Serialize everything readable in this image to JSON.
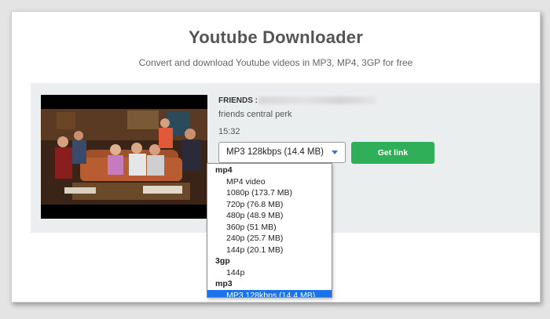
{
  "header": {
    "title": "Youtube Downloader",
    "subtitle": "Convert and download Youtube videos in MP3, MP4, 3GP for free"
  },
  "video": {
    "title_prefix": "FRIENDS :",
    "description": "friends central perk",
    "duration": "15:32"
  },
  "format_select": {
    "selected_value": "MP3 128kbps (14.4 MB)",
    "groups": [
      {
        "label": "mp4",
        "options": [
          "MP4 video",
          "1080p (173.7 MB)",
          "720p (76.8 MB)",
          "480p (48.9 MB)",
          "360p (51 MB)",
          "240p (25.7 MB)",
          "144p (20.1 MB)"
        ]
      },
      {
        "label": "3gp",
        "options": [
          "144p"
        ]
      },
      {
        "label": "mp3",
        "options": [
          "MP3 128kbps (14.4 MB)"
        ]
      }
    ]
  },
  "actions": {
    "get_link_label": "Get link"
  },
  "colors": {
    "accent_green": "#2faf57",
    "selected_blue": "#1a73e8",
    "panel_bg": "#ebeeef"
  }
}
